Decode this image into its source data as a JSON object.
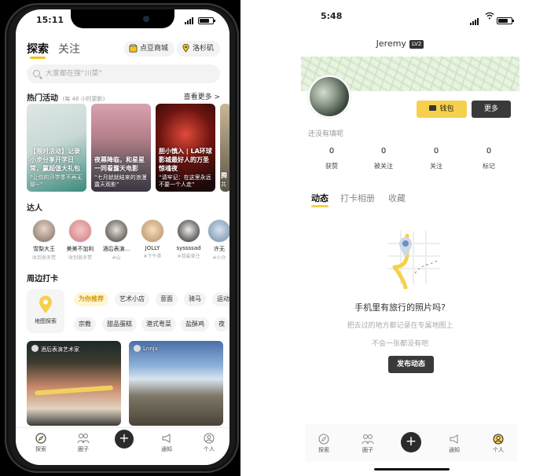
{
  "left": {
    "status_time": "15:11",
    "tabs": [
      "探索",
      "关注"
    ],
    "shop_label": "点豆商城",
    "city_label": "洛杉矶",
    "search_placeholder": "大家都在搜“川菜”",
    "hot": {
      "title": "热门活动",
      "subtitle": "(每 48 小时更新)",
      "more": "查看更多 >",
      "cards": [
        {
          "title": "【限时活动】记录小步分享开学日常，赢超值大礼包",
          "sub": "“让你的开学季不再无聊~”"
        },
        {
          "title": "夜幕降临，和星星一同看露天电影",
          "sub": "“七月就就结来的浪漫露天观影”"
        },
        {
          "title": "胆小慎入 | LA环球影城最好人的万圣惊魂夜",
          "sub": "“请牢记：在这里永远不要一个人走”"
        },
        {
          "title": "腾",
          "sub": "共"
        }
      ]
    },
    "people": {
      "title": "达人",
      "list": [
        {
          "name": "雪梨大王",
          "tag": "收到很多赞"
        },
        {
          "name": "美美不加利",
          "tag": "收到很多赞"
        },
        {
          "name": "酒后表演...",
          "tag": "#山"
        },
        {
          "name": "JOLLY",
          "tag": "#下午茶"
        },
        {
          "name": "syssssad",
          "tag": "#我最爱住"
        },
        {
          "name": "许无",
          "tag": "#小众"
        }
      ]
    },
    "nearby": {
      "title": "周边打卡",
      "map_label": "地图探索",
      "chips_row1": [
        "为你推荐",
        "艺术小店",
        "意面",
        "骑马",
        "运动"
      ],
      "chips_row2": [
        "宗教",
        "甜品蛋糕",
        "港式粤菜",
        "盐酥鸡",
        "夜"
      ]
    },
    "feed": [
      {
        "user": "酒后表演艺术家"
      },
      {
        "user": "Lnnjx"
      }
    ],
    "tabbar": [
      "探索",
      "圈子",
      "+",
      "通知",
      "个人"
    ]
  },
  "right": {
    "status_time": "5:48",
    "username": "Jeremy",
    "level": "LV2",
    "wallet_label": "钱包",
    "more_label": "更多",
    "bio": "还没有填呢",
    "stats": [
      {
        "value": "0",
        "label": "获赞"
      },
      {
        "value": "0",
        "label": "被关注"
      },
      {
        "value": "0",
        "label": "关注"
      },
      {
        "value": "0",
        "label": "标记"
      }
    ],
    "tabs": [
      "动态",
      "打卡相册",
      "收藏"
    ],
    "empty_title": "手机里有旅行的照片吗?",
    "empty_line1": "把去过的地方都记录在专属地图上",
    "empty_line2": "不会一张都没有吧",
    "post_label": "发布动态",
    "tabbar": [
      "探索",
      "圈子",
      "+",
      "通知",
      "个人"
    ]
  },
  "colors": {
    "accent": "#f6d04d",
    "dark": "#2b2b2b",
    "muted": "#999999"
  }
}
